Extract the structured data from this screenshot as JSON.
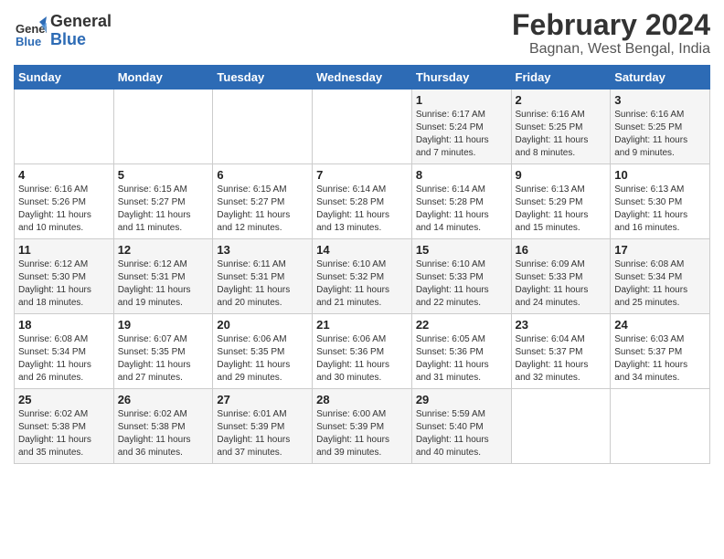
{
  "logo": {
    "name": "General",
    "name2": "Blue"
  },
  "title": "February 2024",
  "subtitle": "Bagnan, West Bengal, India",
  "headers": [
    "Sunday",
    "Monday",
    "Tuesday",
    "Wednesday",
    "Thursday",
    "Friday",
    "Saturday"
  ],
  "weeks": [
    [
      {
        "day": "",
        "info": ""
      },
      {
        "day": "",
        "info": ""
      },
      {
        "day": "",
        "info": ""
      },
      {
        "day": "",
        "info": ""
      },
      {
        "day": "1",
        "info": "Sunrise: 6:17 AM\nSunset: 5:24 PM\nDaylight: 11 hours\nand 7 minutes."
      },
      {
        "day": "2",
        "info": "Sunrise: 6:16 AM\nSunset: 5:25 PM\nDaylight: 11 hours\nand 8 minutes."
      },
      {
        "day": "3",
        "info": "Sunrise: 6:16 AM\nSunset: 5:25 PM\nDaylight: 11 hours\nand 9 minutes."
      }
    ],
    [
      {
        "day": "4",
        "info": "Sunrise: 6:16 AM\nSunset: 5:26 PM\nDaylight: 11 hours\nand 10 minutes."
      },
      {
        "day": "5",
        "info": "Sunrise: 6:15 AM\nSunset: 5:27 PM\nDaylight: 11 hours\nand 11 minutes."
      },
      {
        "day": "6",
        "info": "Sunrise: 6:15 AM\nSunset: 5:27 PM\nDaylight: 11 hours\nand 12 minutes."
      },
      {
        "day": "7",
        "info": "Sunrise: 6:14 AM\nSunset: 5:28 PM\nDaylight: 11 hours\nand 13 minutes."
      },
      {
        "day": "8",
        "info": "Sunrise: 6:14 AM\nSunset: 5:28 PM\nDaylight: 11 hours\nand 14 minutes."
      },
      {
        "day": "9",
        "info": "Sunrise: 6:13 AM\nSunset: 5:29 PM\nDaylight: 11 hours\nand 15 minutes."
      },
      {
        "day": "10",
        "info": "Sunrise: 6:13 AM\nSunset: 5:30 PM\nDaylight: 11 hours\nand 16 minutes."
      }
    ],
    [
      {
        "day": "11",
        "info": "Sunrise: 6:12 AM\nSunset: 5:30 PM\nDaylight: 11 hours\nand 18 minutes."
      },
      {
        "day": "12",
        "info": "Sunrise: 6:12 AM\nSunset: 5:31 PM\nDaylight: 11 hours\nand 19 minutes."
      },
      {
        "day": "13",
        "info": "Sunrise: 6:11 AM\nSunset: 5:31 PM\nDaylight: 11 hours\nand 20 minutes."
      },
      {
        "day": "14",
        "info": "Sunrise: 6:10 AM\nSunset: 5:32 PM\nDaylight: 11 hours\nand 21 minutes."
      },
      {
        "day": "15",
        "info": "Sunrise: 6:10 AM\nSunset: 5:33 PM\nDaylight: 11 hours\nand 22 minutes."
      },
      {
        "day": "16",
        "info": "Sunrise: 6:09 AM\nSunset: 5:33 PM\nDaylight: 11 hours\nand 24 minutes."
      },
      {
        "day": "17",
        "info": "Sunrise: 6:08 AM\nSunset: 5:34 PM\nDaylight: 11 hours\nand 25 minutes."
      }
    ],
    [
      {
        "day": "18",
        "info": "Sunrise: 6:08 AM\nSunset: 5:34 PM\nDaylight: 11 hours\nand 26 minutes."
      },
      {
        "day": "19",
        "info": "Sunrise: 6:07 AM\nSunset: 5:35 PM\nDaylight: 11 hours\nand 27 minutes."
      },
      {
        "day": "20",
        "info": "Sunrise: 6:06 AM\nSunset: 5:35 PM\nDaylight: 11 hours\nand 29 minutes."
      },
      {
        "day": "21",
        "info": "Sunrise: 6:06 AM\nSunset: 5:36 PM\nDaylight: 11 hours\nand 30 minutes."
      },
      {
        "day": "22",
        "info": "Sunrise: 6:05 AM\nSunset: 5:36 PM\nDaylight: 11 hours\nand 31 minutes."
      },
      {
        "day": "23",
        "info": "Sunrise: 6:04 AM\nSunset: 5:37 PM\nDaylight: 11 hours\nand 32 minutes."
      },
      {
        "day": "24",
        "info": "Sunrise: 6:03 AM\nSunset: 5:37 PM\nDaylight: 11 hours\nand 34 minutes."
      }
    ],
    [
      {
        "day": "25",
        "info": "Sunrise: 6:02 AM\nSunset: 5:38 PM\nDaylight: 11 hours\nand 35 minutes."
      },
      {
        "day": "26",
        "info": "Sunrise: 6:02 AM\nSunset: 5:38 PM\nDaylight: 11 hours\nand 36 minutes."
      },
      {
        "day": "27",
        "info": "Sunrise: 6:01 AM\nSunset: 5:39 PM\nDaylight: 11 hours\nand 37 minutes."
      },
      {
        "day": "28",
        "info": "Sunrise: 6:00 AM\nSunset: 5:39 PM\nDaylight: 11 hours\nand 39 minutes."
      },
      {
        "day": "29",
        "info": "Sunrise: 5:59 AM\nSunset: 5:40 PM\nDaylight: 11 hours\nand 40 minutes."
      },
      {
        "day": "",
        "info": ""
      },
      {
        "day": "",
        "info": ""
      }
    ]
  ]
}
